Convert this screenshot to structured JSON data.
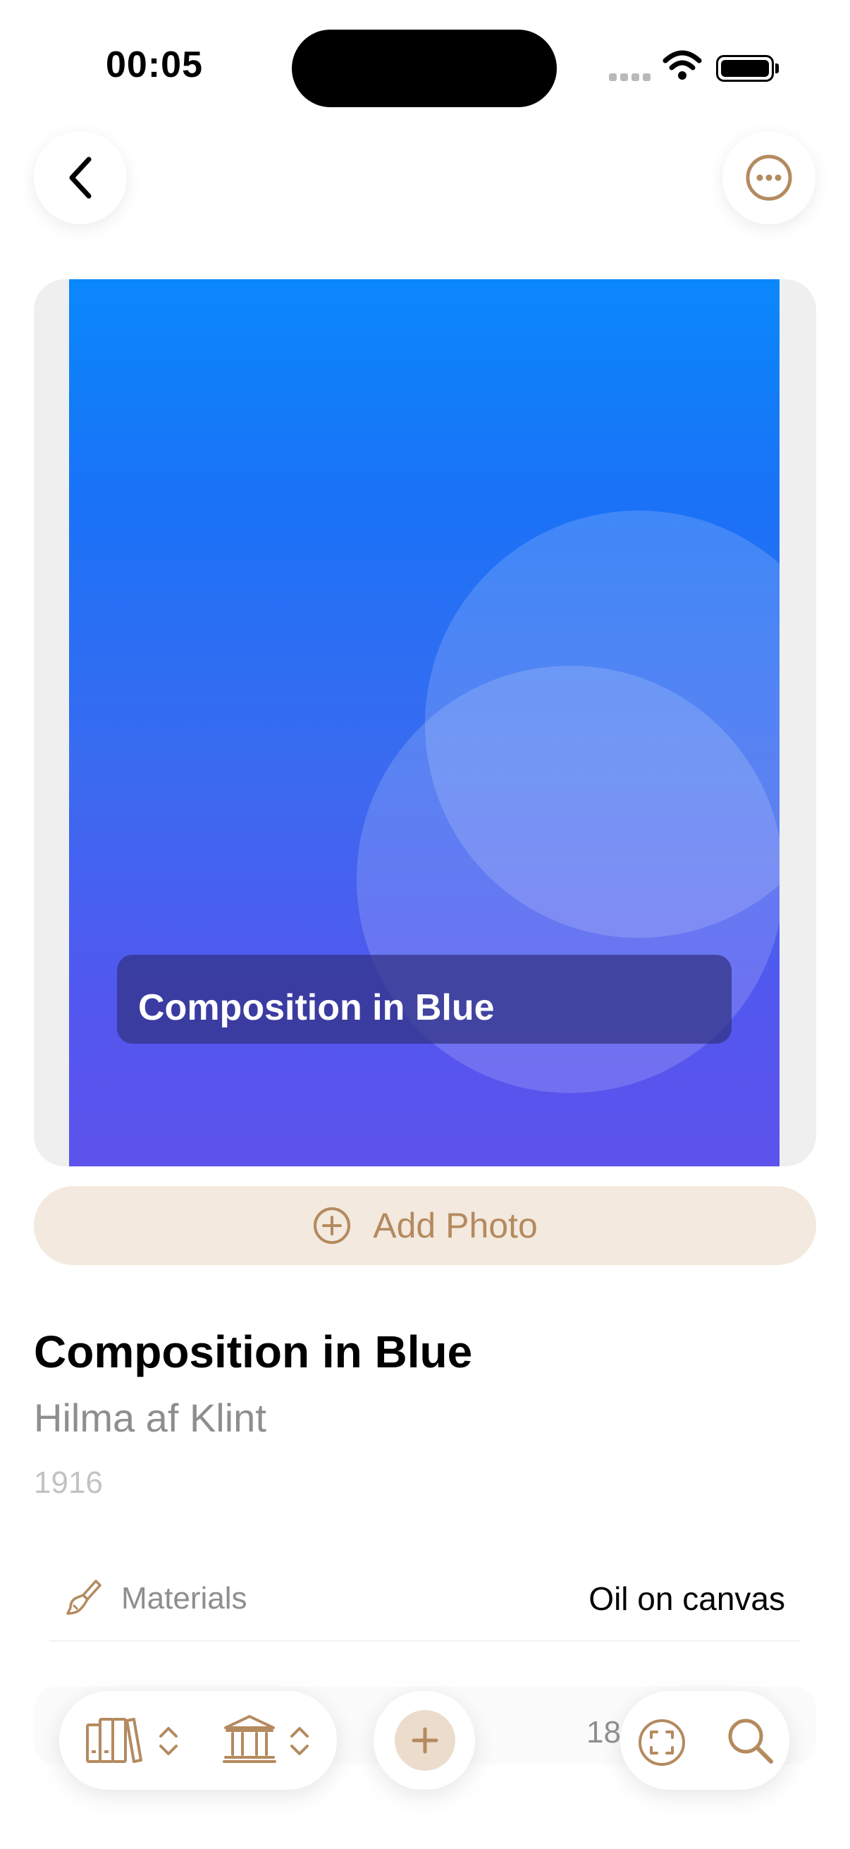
{
  "status_bar": {
    "time": "00:05"
  },
  "nav": {
    "back_icon": "chevron-left-icon",
    "more_icon": "ellipsis-circle-icon"
  },
  "artwork": {
    "caption": "Composition in Blue",
    "gradient_top": "#0a88fb",
    "gradient_bottom": "#5d52ec"
  },
  "add_photo": {
    "label": "Add Photo",
    "icon": "plus-circle-icon"
  },
  "details": {
    "title": "Composition in Blue",
    "artist": "Hilma af Klint",
    "year": "1916"
  },
  "materials": {
    "label": "Materials",
    "value": "Oil on canvas",
    "icon": "paintbrush-icon"
  },
  "toolbar": {
    "collection_icon": "books-icon",
    "museum_icon": "museum-icon",
    "add_icon": "plus-icon",
    "count": "18",
    "scan_icon": "viewfinder-icon",
    "search_icon": "search-icon"
  },
  "colors": {
    "accent": "#b48a5f",
    "accent_soft": "#f3e9de"
  }
}
